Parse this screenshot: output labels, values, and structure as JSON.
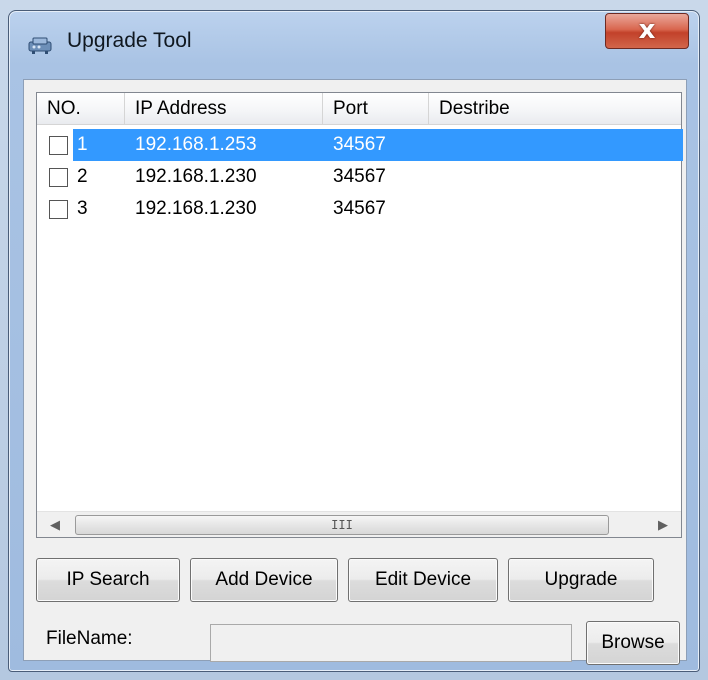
{
  "window": {
    "title": "Upgrade Tool",
    "close_glyph": "x"
  },
  "list": {
    "columns": [
      "NO.",
      "IP Address",
      "Port",
      "Destribe"
    ],
    "rows": [
      {
        "no": "1",
        "ip": "192.168.1.253",
        "port": "34567",
        "describe": "",
        "selected": true,
        "checked": false
      },
      {
        "no": "2",
        "ip": "192.168.1.230",
        "port": "34567",
        "describe": "",
        "selected": false,
        "checked": false
      },
      {
        "no": "3",
        "ip": "192.168.1.230",
        "port": "34567",
        "describe": "",
        "selected": false,
        "checked": false
      }
    ],
    "scroll_left": "◀",
    "scroll_right": "▶",
    "scroll_grip": "III"
  },
  "buttons": {
    "ip_search": "IP Search",
    "add_device": "Add Device",
    "edit_device": "Edit Device",
    "upgrade": "Upgrade",
    "browse": "Browse"
  },
  "file": {
    "label": "FileName:",
    "value": ""
  },
  "colors": {
    "selection": "#3399ff",
    "close_button": "#c2412a"
  },
  "icons": {
    "title": "network-device-icon",
    "close": "close-icon"
  }
}
